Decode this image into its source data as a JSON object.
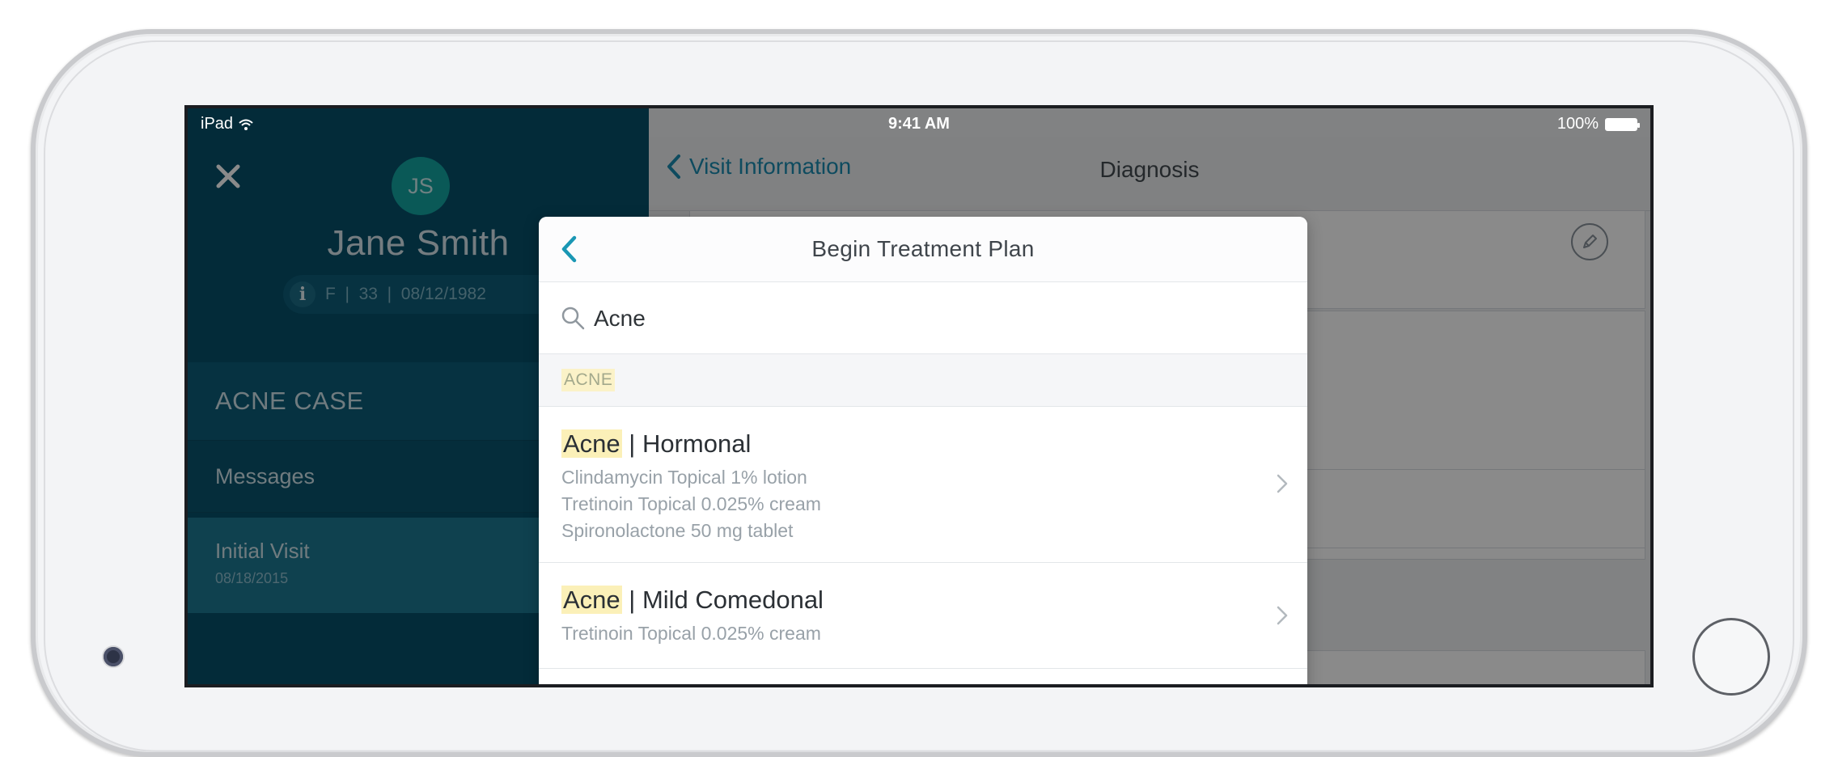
{
  "status_bar": {
    "device": "iPad",
    "time": "9:41 AM",
    "battery": "100%"
  },
  "sidebar": {
    "avatar_initials": "JS",
    "patient_name": "Jane Smith",
    "patient_info": "F  |  33  |  08/12/1982",
    "case_title": "ACNE CASE",
    "messages_label": "Messages",
    "visit_label": "Initial Visit",
    "visit_date": "08/18/2015"
  },
  "main": {
    "back_label": "Visit Information",
    "title": "Diagnosis"
  },
  "modal": {
    "title": "Begin Treatment Plan",
    "search_value": "Acne",
    "section_header": "ACNE",
    "results": [
      {
        "highlight": "Acne",
        "rest": " | Hormonal",
        "lines": [
          "Clindamycin Topical 1% lotion",
          "Tretinoin Topical 0.025% cream",
          "Spironolactone 50 mg tablet"
        ]
      },
      {
        "highlight": "Acne",
        "rest": " | Mild Comedonal",
        "lines": [
          "Tretinoin Topical 0.025% cream"
        ]
      }
    ]
  },
  "colors": {
    "sidebar": "#07506a",
    "accent": "#1a8bb0",
    "avatar": "#13a4a1",
    "highlight": "#fbf0b8"
  },
  "icons": [
    "wifi-icon",
    "battery-icon",
    "close-icon",
    "info-icon",
    "back-chevron-icon",
    "pencil-icon",
    "search-icon",
    "chevron-right-icon"
  ]
}
